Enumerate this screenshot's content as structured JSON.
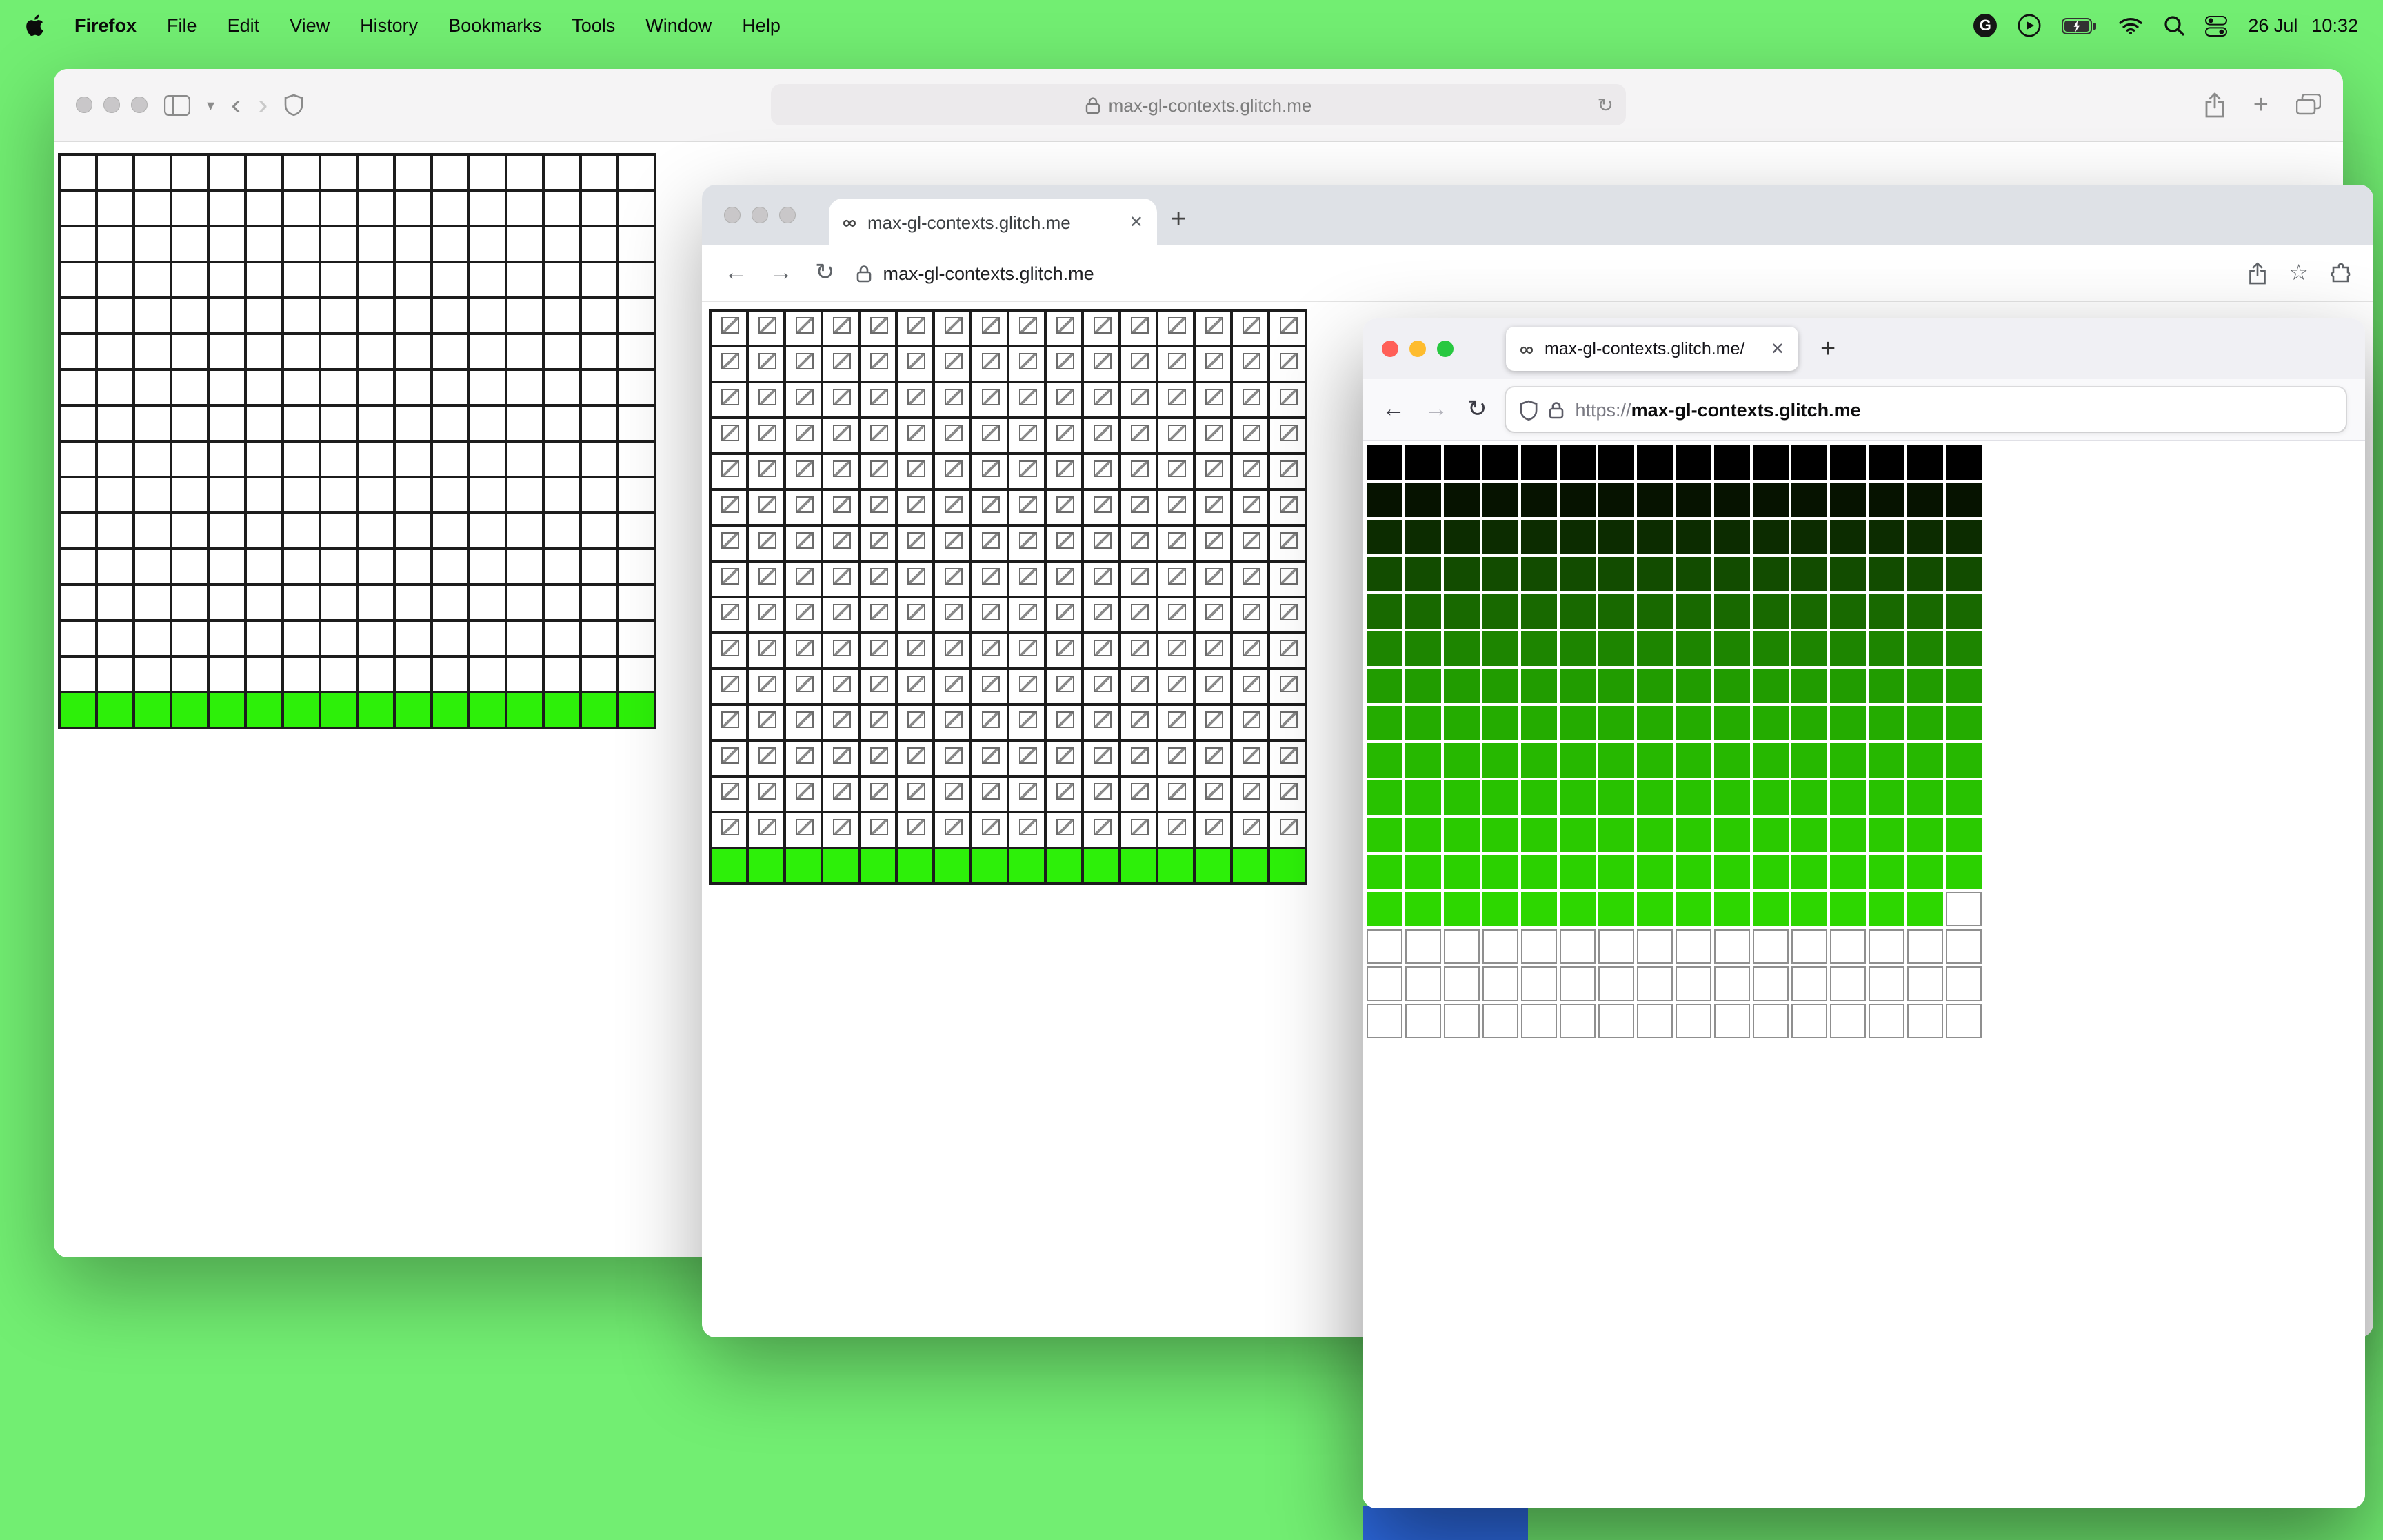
{
  "desktop": {
    "background_color": "#72ee72",
    "peek_color": "#2e6ce6"
  },
  "icons": {
    "close": "✕",
    "new_tab": "+",
    "reload": "↻",
    "back": "←",
    "forward": "→",
    "back_chevron": "‹",
    "forward_chevron": "›",
    "chevron_down": "▾",
    "star": "☆",
    "infinity": "∞",
    "g_badge": "G"
  },
  "menu_bar": {
    "app_name": "Firefox",
    "menus": [
      "File",
      "Edit",
      "View",
      "History",
      "Bookmarks",
      "Tools",
      "Window",
      "Help"
    ],
    "date": "26 Jul",
    "time": "10:32"
  },
  "safari": {
    "url": "max-gl-contexts.glitch.me",
    "grid": {
      "type": "plain",
      "cols": 16,
      "white_rows": 15,
      "green_rows": 1,
      "cell_color": "#ffffff",
      "green_color": "#2df009",
      "broken_icon": false
    }
  },
  "chrome": {
    "tab_title": "max-gl-contexts.glitch.me",
    "url": "max-gl-contexts.glitch.me",
    "grid": {
      "type": "plain",
      "cols": 16,
      "white_rows": 15,
      "green_rows": 1,
      "cell_color": "#ffffff",
      "green_color": "#2df009",
      "broken_icon": true
    }
  },
  "firefox": {
    "tab_title": "max-gl-contexts.glitch.me/",
    "url_scheme": "https://",
    "url_host": "max-gl-contexts.glitch.me",
    "grid": {
      "type": "gradient",
      "cols": 16,
      "row_colors": [
        "#000000",
        "#061300",
        "#0c2c00",
        "#124c00",
        "#186900",
        "#1d8500",
        "#219c00",
        "#24ac00",
        "#26b800",
        "#28c200",
        "#2aca00",
        "#2bd100",
        "#2dd700"
      ],
      "last_row_white_cells": 1,
      "trailing_white_rows": 3
    }
  }
}
